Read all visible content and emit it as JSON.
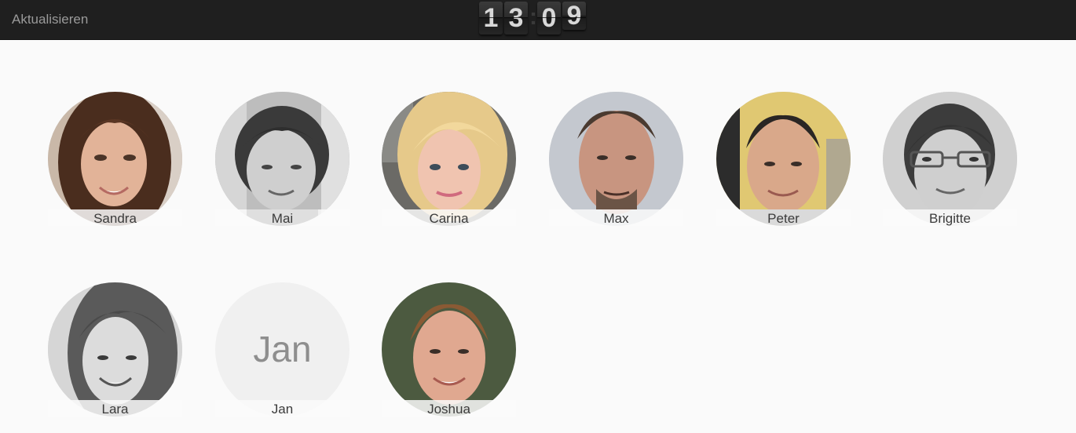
{
  "topbar": {
    "refresh_label": "Aktualisieren",
    "clock": {
      "h1": "1",
      "h2": "3",
      "m1": "0",
      "m2": "9"
    }
  },
  "people": [
    {
      "name": "Sandra",
      "style": "color"
    },
    {
      "name": "Mai",
      "style": "grayscale"
    },
    {
      "name": "Carina",
      "style": "color"
    },
    {
      "name": "Max",
      "style": "color"
    },
    {
      "name": "Peter",
      "style": "color"
    },
    {
      "name": "Brigitte",
      "style": "grayscale"
    },
    {
      "name": "Lara",
      "style": "grayscale"
    },
    {
      "name": "Jan",
      "style": "placeholder",
      "initials": "Jan"
    },
    {
      "name": "Joshua",
      "style": "color"
    }
  ],
  "colors": {
    "topbar_bg": "#1f1f1f",
    "page_bg": "#fafafa",
    "label_text": "#3b3b3b"
  }
}
